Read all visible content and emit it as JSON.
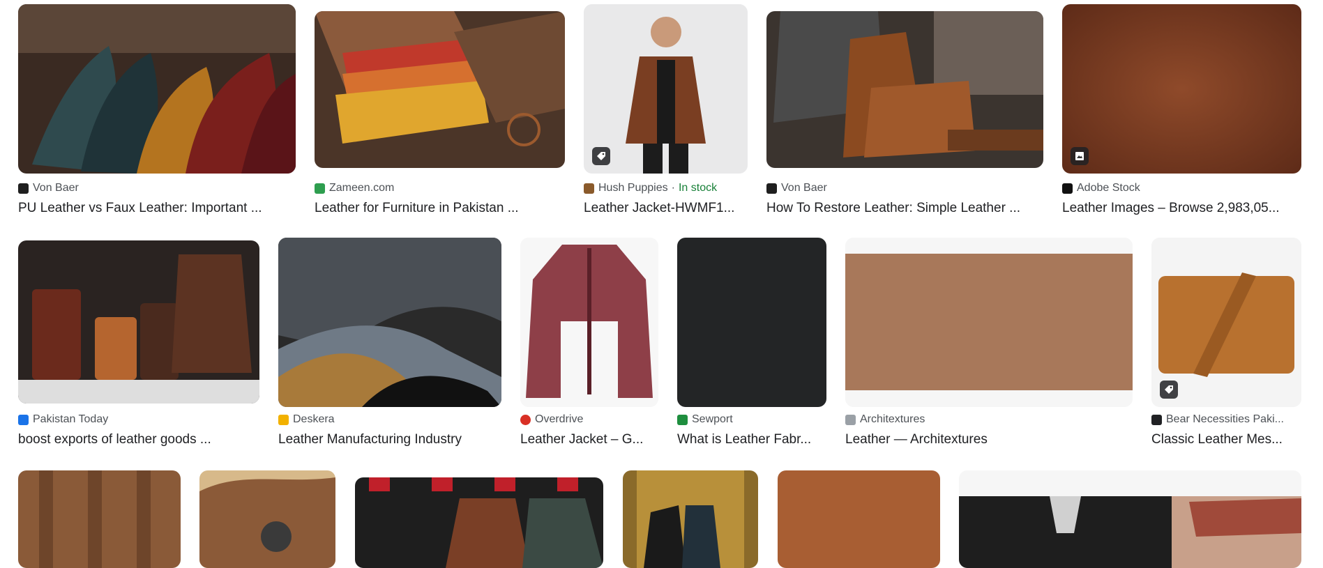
{
  "results": [
    {
      "source": "Von Baer",
      "title": "PU Leather vs Faux Leather: Important ...",
      "favicon_color": "#1f1f1f",
      "image_icon": "leather-hides-image-icon"
    },
    {
      "source": "Zameen.com",
      "title": "Leather for Furniture in Pakistan ...",
      "favicon_color": "#2e9e4f",
      "image_icon": "leather-swatches-image-icon"
    },
    {
      "source": "Hush Puppies",
      "separator": "·",
      "stock": "In stock",
      "title": "Leather Jacket-HWMF1...",
      "favicon_color": "#8a5a2b",
      "image_icon": "man-jacket-image-icon",
      "badge_icon": "tag-icon"
    },
    {
      "source": "Von Baer",
      "title": "How To Restore Leather: Simple Leather ...",
      "favicon_color": "#1f1f1f",
      "image_icon": "craftsman-bag-image-icon"
    },
    {
      "source": "Adobe Stock",
      "title": "Leather Images – Browse 2,983,05...",
      "favicon_color": "#111111",
      "image_icon": "brown-texture-image-icon",
      "badge_icon": "image-icon"
    },
    {
      "source": "Pakistan Today",
      "title": "boost exports of leather goods ...",
      "favicon_color": "#1a73e8",
      "image_icon": "leather-goods-image-icon"
    },
    {
      "source": "Deskera",
      "title": "Leather Manufacturing Industry",
      "favicon_color": "#f2b100",
      "image_icon": "leather-folds-image-icon"
    },
    {
      "source": "Overdrive",
      "title": "Leather Jacket – G...",
      "favicon_color": "#d93025",
      "image_icon": "red-jacket-image-icon"
    },
    {
      "source": "Sewport",
      "title": "What is Leather Fabr...",
      "favicon_color": "#1e8e3e",
      "image_icon": "black-texture-image-icon"
    },
    {
      "source": "Architextures",
      "title": "Leather — Architextures",
      "favicon_color": "#9aa0a6",
      "image_icon": "tan-texture-image-icon"
    },
    {
      "source": "Bear Necessities Paki...",
      "title": "Classic Leather Mes...",
      "favicon_color": "#202124",
      "image_icon": "messenger-bag-image-icon",
      "badge_icon": "tag-icon"
    },
    {
      "image_icon": "brown-leather-rolls-image-icon"
    },
    {
      "image_icon": "leather-shoes-image-icon"
    },
    {
      "image_icon": "leather-jackets-rack-image-icon"
    },
    {
      "image_icon": "fashion-models-image-icon"
    },
    {
      "image_icon": "cognac-texture-image-icon"
    },
    {
      "image_icon": "black-jacket-collage-image-icon"
    }
  ]
}
